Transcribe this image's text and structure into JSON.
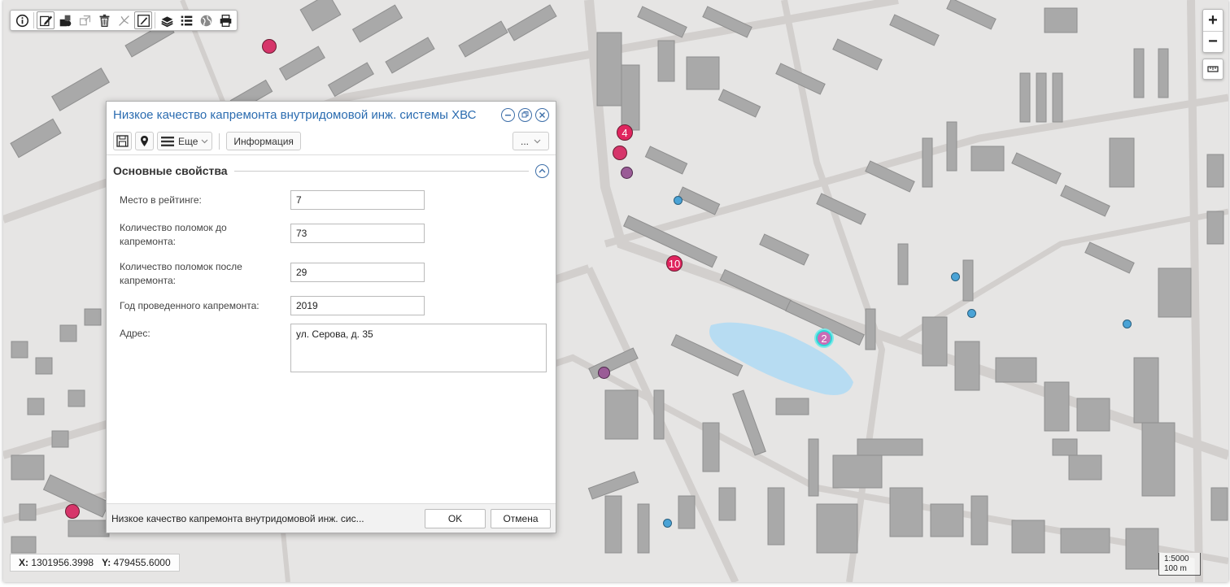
{
  "toolbar": {
    "tools": [
      {
        "name": "info-icon"
      },
      {
        "name": "edit-icon"
      },
      {
        "name": "shapes-icon"
      },
      {
        "name": "copy-icon"
      },
      {
        "name": "trash-icon"
      },
      {
        "name": "split-icon"
      },
      {
        "name": "edit-box-icon"
      },
      {
        "name": "layers-icon"
      },
      {
        "name": "list-icon"
      },
      {
        "name": "globe-icon"
      },
      {
        "name": "print-icon"
      }
    ]
  },
  "zoom": {
    "in": "+",
    "out": "−"
  },
  "coords": {
    "x_label": "X:",
    "x_value": "1301956.3998",
    "y_label": "Y:",
    "y_value": "479455.6000"
  },
  "scale": {
    "ratio": "1:5000",
    "distance": "100 m"
  },
  "markers": {
    "m4": "4",
    "m10": "10",
    "m2": "2"
  },
  "dialog": {
    "title": "Низкое качество капремонта внутридомовой инж. системы ХВС",
    "toolbar": {
      "more_label": "Еще",
      "info_label": "Информация",
      "ellipsis_label": "..."
    },
    "section_title": "Основные свойства",
    "fields": {
      "rank": {
        "label": "Место в рейтинге:",
        "value": "7"
      },
      "before": {
        "label_1": "Количество поломок до",
        "label_2": "капремонта:",
        "value": "73"
      },
      "after": {
        "label_1": "Количество поломок после",
        "label_2": "капремонта:",
        "value": "29"
      },
      "year": {
        "label": "Год проведенного капремонта:",
        "value": "2019"
      },
      "address": {
        "label": "Адрес:",
        "value": "ул. Серова, д. 35"
      }
    },
    "footer": {
      "text": "Низкое качество капремонта внутридомовой инж. сис...",
      "ok_label": "OK",
      "cancel_label": "Отмена"
    }
  },
  "colors": {
    "map_bg": "#e6e5e4",
    "building": "#a9a9a9",
    "road": "#d2cfcd",
    "water": "#b7dcf2",
    "accent": "#2b6cb0",
    "marker_red": "#d6356a",
    "marker_purple": "#9a5b96",
    "marker_blue": "#4aa3d6"
  }
}
